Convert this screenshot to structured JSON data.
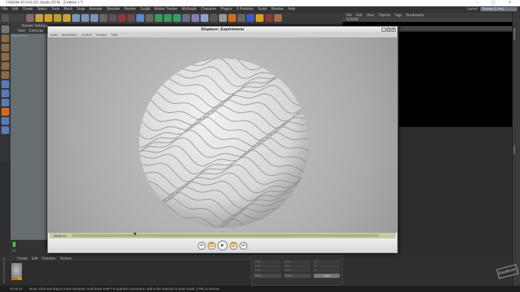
{
  "app": {
    "title": "CINEMA 4D R16.021 Studio (RTB) - [Untitled 1 *]",
    "layout_label": "Layout:",
    "layout_value": "Startup (User)"
  },
  "menubar": [
    "File",
    "Edit",
    "Create",
    "Select",
    "Tools",
    "Mesh",
    "Snap",
    "Animate",
    "Simulate",
    "Render",
    "Sculpt",
    "Motion Tracker",
    "MoGraph",
    "Character",
    "Plugins",
    "X-Particles",
    "Script",
    "Window",
    "Help"
  ],
  "viewport": {
    "tab": "Render Settings",
    "menu": [
      "View",
      "Cameras"
    ],
    "label": "Perspective"
  },
  "object_manager": {
    "menu": [
      "File",
      "Edit",
      "View",
      "Objects",
      "Tags",
      "Bookmarks"
    ],
    "rows": [
      "SCENE",
      "",
      ""
    ]
  },
  "right_tabs": [
    "Structure",
    "Layers"
  ],
  "picture_viewer": {
    "title": "Displacer_Experiments",
    "menu": [
      "Datei",
      "Bearbeiten",
      "Ansicht",
      "Fenster",
      "Hilfe"
    ],
    "timecode": "00:00:10",
    "playhead_fraction": 0.2,
    "controls": [
      "skip-start",
      "rewind",
      "play",
      "fast-forward",
      "skip-end"
    ]
  },
  "timeline": {
    "frame": "0 F"
  },
  "material_manager": {
    "menu": [
      "Create",
      "Edit",
      "Function",
      "Texture"
    ],
    "material": "Shader"
  },
  "coordinates": {
    "fields": [
      "0 cm",
      "0 cm",
      "0 °",
      "0 cm",
      "0 cm",
      "0 °",
      "0 cm",
      "0 cm",
      "0 °"
    ],
    "axes": [
      "X",
      "Y",
      "Z"
    ],
    "mode": "World",
    "scale": "Scale",
    "apply": "Apply"
  },
  "status": {
    "time": "00:00:10",
    "message": "Move: Click and drag to move elements. Hold down SHIFT to quantize movement / add to the selection in point mode, CTRL to remove."
  },
  "brand": {
    "maxon": "MAXON CINEMA 4D",
    "watermark": "Equilibrium"
  }
}
